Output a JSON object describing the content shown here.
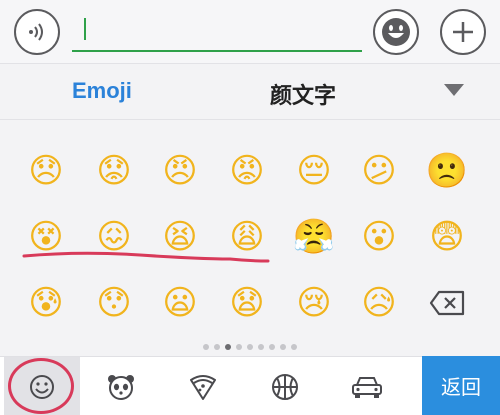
{
  "input": {
    "placeholder": "",
    "value": ""
  },
  "icons": {
    "voice": "voice-wave-icon",
    "emoji_toggle": "smiley-face-icon",
    "add": "plus-icon",
    "dropdown": "triangle-down-icon",
    "backspace": "backspace-icon"
  },
  "tabs": [
    {
      "label": "Emoji",
      "active": true
    },
    {
      "label": "颜文字",
      "active": false
    }
  ],
  "emoji_rows": [
    [
      "😞",
      "😟",
      "😠",
      "😡",
      "😔",
      "😕",
      "🙁"
    ],
    [
      "😵",
      "😖",
      "😫",
      "😩",
      "😤",
      "😮",
      "😨"
    ],
    [
      "😰",
      "😯",
      "😦",
      "😧",
      "😢",
      "😥",
      "⌫"
    ]
  ],
  "pagination": {
    "current": 3,
    "total": 10
  },
  "bottom_tabs": [
    {
      "icon": "smiley-icon",
      "active": true
    },
    {
      "icon": "panda-icon",
      "active": false
    },
    {
      "icon": "pizza-icon",
      "active": false
    },
    {
      "icon": "basketball-icon",
      "active": false
    },
    {
      "icon": "car-icon",
      "active": false
    }
  ],
  "return_label": "返回",
  "colors": {
    "accent": "#2b82d9",
    "return_bg": "#2b8ede",
    "annotation": "#d83a5a",
    "cursor": "#2fa14a"
  }
}
